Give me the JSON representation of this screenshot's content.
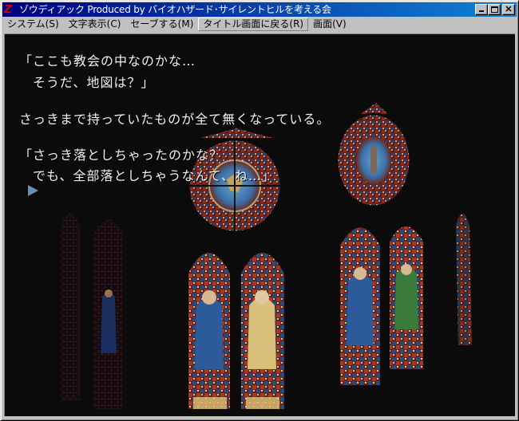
{
  "window": {
    "title": "ゾウディアック  Produced by バイオハザード･サイレントヒルを考える会",
    "app_icon": "Z",
    "buttons": {
      "minimize": "minimize",
      "maximize": "maximize",
      "close": "✕"
    }
  },
  "menu": {
    "items": [
      {
        "label": "システム",
        "key": "(S)"
      },
      {
        "label": "文字表示",
        "key": "(C)"
      },
      {
        "label": "セーブする",
        "key": "(M)"
      },
      {
        "label": "タイトル画面に戻る",
        "key": "(R)"
      },
      {
        "label": "画面",
        "key": "(V)"
      }
    ]
  },
  "scene": {
    "background": "cathedral stained glass windows at night",
    "colors": {
      "text": "#f2f2f2",
      "cursor": "#6f8fb0",
      "background": "#0a0a0a"
    }
  },
  "dialogue": {
    "lines": [
      "「ここも教会の中なのかな…",
      "　そうだ、地図は？」",
      "",
      "さっきまで持っていたものが全て無くなっている。",
      "",
      "「さっき落としちゃったのかな？",
      "　でも、全部落としちゃうなんて、ね…」"
    ],
    "continue_indicator": "next-page-arrow"
  }
}
